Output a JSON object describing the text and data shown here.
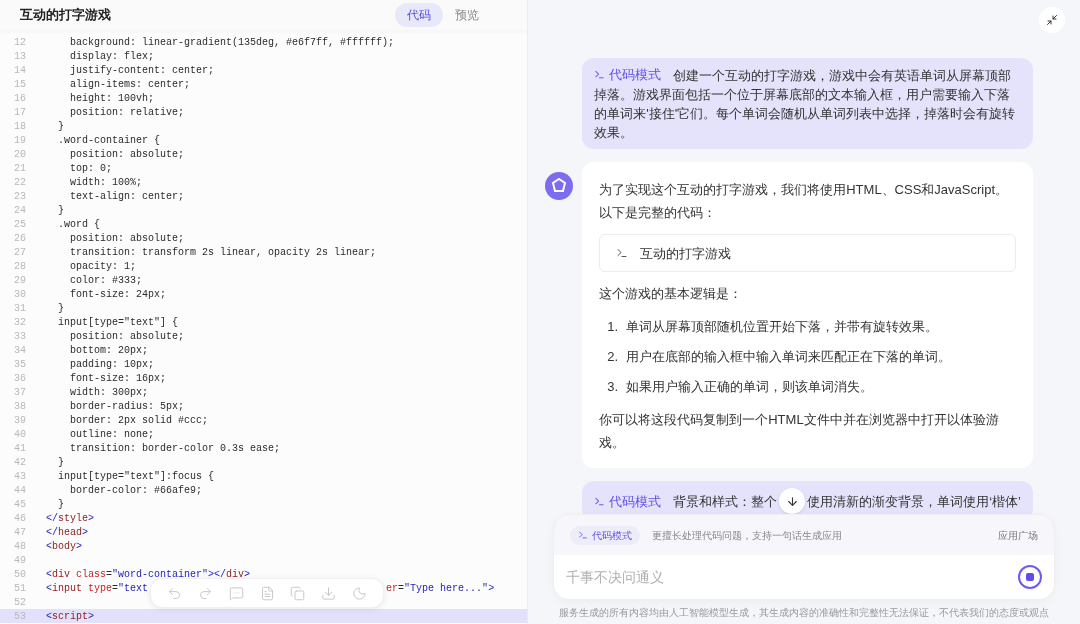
{
  "header": {
    "title": "互动的打字游戏",
    "tabs": [
      {
        "label": "代码",
        "selected": true
      },
      {
        "label": "预览",
        "selected": false
      }
    ]
  },
  "code": {
    "lines": [
      {
        "number": "12",
        "selected": false,
        "segments": [
          {
            "kind": "plain",
            "text": "    background: linear-gradient(135deg, #e6f7ff, #ffffff);"
          }
        ]
      },
      {
        "number": "13",
        "selected": false,
        "segments": [
          {
            "kind": "plain",
            "text": "    display: flex;"
          }
        ]
      },
      {
        "number": "14",
        "selected": false,
        "segments": [
          {
            "kind": "plain",
            "text": "    justify-content: center;"
          }
        ]
      },
      {
        "number": "15",
        "selected": false,
        "segments": [
          {
            "kind": "plain",
            "text": "    align-items: center;"
          }
        ]
      },
      {
        "number": "16",
        "selected": false,
        "segments": [
          {
            "kind": "plain",
            "text": "    height: 100vh;"
          }
        ]
      },
      {
        "number": "17",
        "selected": false,
        "segments": [
          {
            "kind": "plain",
            "text": "    position: relative;"
          }
        ]
      },
      {
        "number": "18",
        "selected": false,
        "segments": [
          {
            "kind": "plain",
            "text": "  }"
          }
        ]
      },
      {
        "number": "19",
        "selected": false,
        "segments": [
          {
            "kind": "plain",
            "text": "  .word-container {"
          }
        ]
      },
      {
        "number": "20",
        "selected": false,
        "segments": [
          {
            "kind": "plain",
            "text": "    position: absolute;"
          }
        ]
      },
      {
        "number": "21",
        "selected": false,
        "segments": [
          {
            "kind": "plain",
            "text": "    top: 0;"
          }
        ]
      },
      {
        "number": "22",
        "selected": false,
        "segments": [
          {
            "kind": "plain",
            "text": "    width: 100%;"
          }
        ]
      },
      {
        "number": "23",
        "selected": false,
        "segments": [
          {
            "kind": "plain",
            "text": "    text-align: center;"
          }
        ]
      },
      {
        "number": "24",
        "selected": false,
        "segments": [
          {
            "kind": "plain",
            "text": "  }"
          }
        ]
      },
      {
        "number": "25",
        "selected": false,
        "segments": [
          {
            "kind": "plain",
            "text": "  .word {"
          }
        ]
      },
      {
        "number": "26",
        "selected": false,
        "segments": [
          {
            "kind": "plain",
            "text": "    position: absolute;"
          }
        ]
      },
      {
        "number": "27",
        "selected": false,
        "segments": [
          {
            "kind": "plain",
            "text": "    transition: transform 2s linear, opacity 2s linear;"
          }
        ]
      },
      {
        "number": "28",
        "selected": false,
        "segments": [
          {
            "kind": "plain",
            "text": "    opacity: 1;"
          }
        ]
      },
      {
        "number": "29",
        "selected": false,
        "segments": [
          {
            "kind": "plain",
            "text": "    color: #333;"
          }
        ]
      },
      {
        "number": "30",
        "selected": false,
        "segments": [
          {
            "kind": "plain",
            "text": "    font-size: 24px;"
          }
        ]
      },
      {
        "number": "31",
        "selected": false,
        "segments": [
          {
            "kind": "plain",
            "text": "  }"
          }
        ]
      },
      {
        "number": "32",
        "selected": false,
        "segments": [
          {
            "kind": "plain",
            "text": "  input[type=\"text\"] {"
          }
        ]
      },
      {
        "number": "33",
        "selected": false,
        "segments": [
          {
            "kind": "plain",
            "text": "    position: absolute;"
          }
        ]
      },
      {
        "number": "34",
        "selected": false,
        "segments": [
          {
            "kind": "plain",
            "text": "    bottom: 20px;"
          }
        ]
      },
      {
        "number": "35",
        "selected": false,
        "segments": [
          {
            "kind": "plain",
            "text": "    padding: 10px;"
          }
        ]
      },
      {
        "number": "36",
        "selected": false,
        "segments": [
          {
            "kind": "plain",
            "text": "    font-size: 16px;"
          }
        ]
      },
      {
        "number": "37",
        "selected": false,
        "segments": [
          {
            "kind": "plain",
            "text": "    width: 300px;"
          }
        ]
      },
      {
        "number": "38",
        "selected": false,
        "segments": [
          {
            "kind": "plain",
            "text": "    border-radius: 5px;"
          }
        ]
      },
      {
        "number": "39",
        "selected": false,
        "segments": [
          {
            "kind": "plain",
            "text": "    border: 2px solid #ccc;"
          }
        ]
      },
      {
        "number": "40",
        "selected": false,
        "segments": [
          {
            "kind": "plain",
            "text": "    outline: none;"
          }
        ]
      },
      {
        "number": "41",
        "selected": false,
        "segments": [
          {
            "kind": "plain",
            "text": "    transition: border-color 0.3s ease;"
          }
        ]
      },
      {
        "number": "42",
        "selected": false,
        "segments": [
          {
            "kind": "plain",
            "text": "  }"
          }
        ]
      },
      {
        "number": "43",
        "selected": false,
        "segments": [
          {
            "kind": "plain",
            "text": "  input[type=\"text\"]:focus {"
          }
        ]
      },
      {
        "number": "44",
        "selected": false,
        "segments": [
          {
            "kind": "plain",
            "text": "    border-color: #66afe9;"
          }
        ]
      },
      {
        "number": "45",
        "selected": false,
        "segments": [
          {
            "kind": "plain",
            "text": "  }"
          }
        ]
      },
      {
        "number": "46",
        "selected": false,
        "segments": [
          {
            "kind": "punct",
            "text": "</"
          },
          {
            "kind": "name",
            "text": "style"
          },
          {
            "kind": "punct",
            "text": ">"
          }
        ]
      },
      {
        "number": "47",
        "selected": false,
        "segments": [
          {
            "kind": "punct",
            "text": "</"
          },
          {
            "kind": "name",
            "text": "head"
          },
          {
            "kind": "punct",
            "text": ">"
          }
        ]
      },
      {
        "number": "48",
        "selected": false,
        "segments": [
          {
            "kind": "punct",
            "text": "<"
          },
          {
            "kind": "name",
            "text": "body"
          },
          {
            "kind": "punct",
            "text": ">"
          }
        ]
      },
      {
        "number": "49",
        "selected": false
      },
      {
        "number": "50",
        "selected": false,
        "segments": [
          {
            "kind": "punct",
            "text": "<"
          },
          {
            "kind": "name",
            "text": "div "
          },
          {
            "kind": "attr",
            "text": "class"
          },
          {
            "kind": "plain",
            "text": "="
          },
          {
            "kind": "string",
            "text": "\"word-container\""
          },
          {
            "kind": "punct",
            "text": "></"
          },
          {
            "kind": "name",
            "text": "div"
          },
          {
            "kind": "punct",
            "text": ">"
          }
        ]
      },
      {
        "number": "51",
        "selected": false,
        "segments": [
          {
            "kind": "punct",
            "text": "<"
          },
          {
            "kind": "name",
            "text": "input "
          },
          {
            "kind": "attr",
            "text": "type"
          },
          {
            "kind": "plain",
            "text": "="
          },
          {
            "kind": "string",
            "text": "\"text"
          }
        ],
        "segments_after": [
          {
            "kind": "attr",
            "text": "er"
          },
          {
            "kind": "plain",
            "text": "="
          },
          {
            "kind": "string",
            "text": "\"Type here...\""
          },
          {
            "kind": "punct",
            "text": ">"
          }
        ]
      },
      {
        "number": "52",
        "selected": false
      },
      {
        "number": "53",
        "selected": true,
        "segments": [
          {
            "kind": "punct",
            "text": "<"
          },
          {
            "kind": "name",
            "text": "script"
          },
          {
            "kind": "punct",
            "text": ">"
          }
        ]
      }
    ]
  },
  "chat": {
    "messages": [
      {
        "kind": "user",
        "mode": "代码模式",
        "text": "创建一个互动的打字游戏，游戏中会有英语单词从屏幕顶部掉落。游戏界面包括一个位于屏幕底部的文本输入框，用户需要输入下落的单词来'接住'它们。每个单词会随机从单词列表中选择，掉落时会有旋转效果。"
      },
      {
        "kind": "assistant",
        "blocks": [
          {
            "kind": "paragraph",
            "text": "为了实现这个互动的打字游戏，我们将使用HTML、CSS和JavaScript。以下是完整的代码："
          },
          {
            "kind": "code_card",
            "title": "互动的打字游戏"
          },
          {
            "kind": "paragraph",
            "text": "这个游戏的基本逻辑是："
          },
          {
            "kind": "list",
            "items": [
              {
                "number": "1.",
                "text": "单词从屏幕顶部随机位置开始下落，并带有旋转效果。"
              },
              {
                "number": "2.",
                "text": "用户在底部的输入框中输入单词来匹配正在下落的单词。"
              },
              {
                "number": "3.",
                "text": "如果用户输入正确的单词，则该单词消失。"
              }
            ]
          },
          {
            "kind": "paragraph",
            "text": "你可以将这段代码复制到一个HTML文件中并在浏览器中打开以体验游戏。"
          }
        ]
      },
      {
        "kind": "user",
        "mode": "代码模式",
        "text": "背景和样式：整个",
        "text_after": "使用清新的渐变背景，单词使用‘楷体’"
      }
    ]
  },
  "composer": {
    "mode": "代码模式",
    "hint": "更擅长处理代码问题，支持一句话生成应用",
    "link": "应用广场",
    "placeholder": "千事不决问通义"
  },
  "disclaimer": "服务生成的所有内容均由人工智能模型生成，其生成内容的准确性和完整性无法保证，不代表我们的态度或观点"
}
